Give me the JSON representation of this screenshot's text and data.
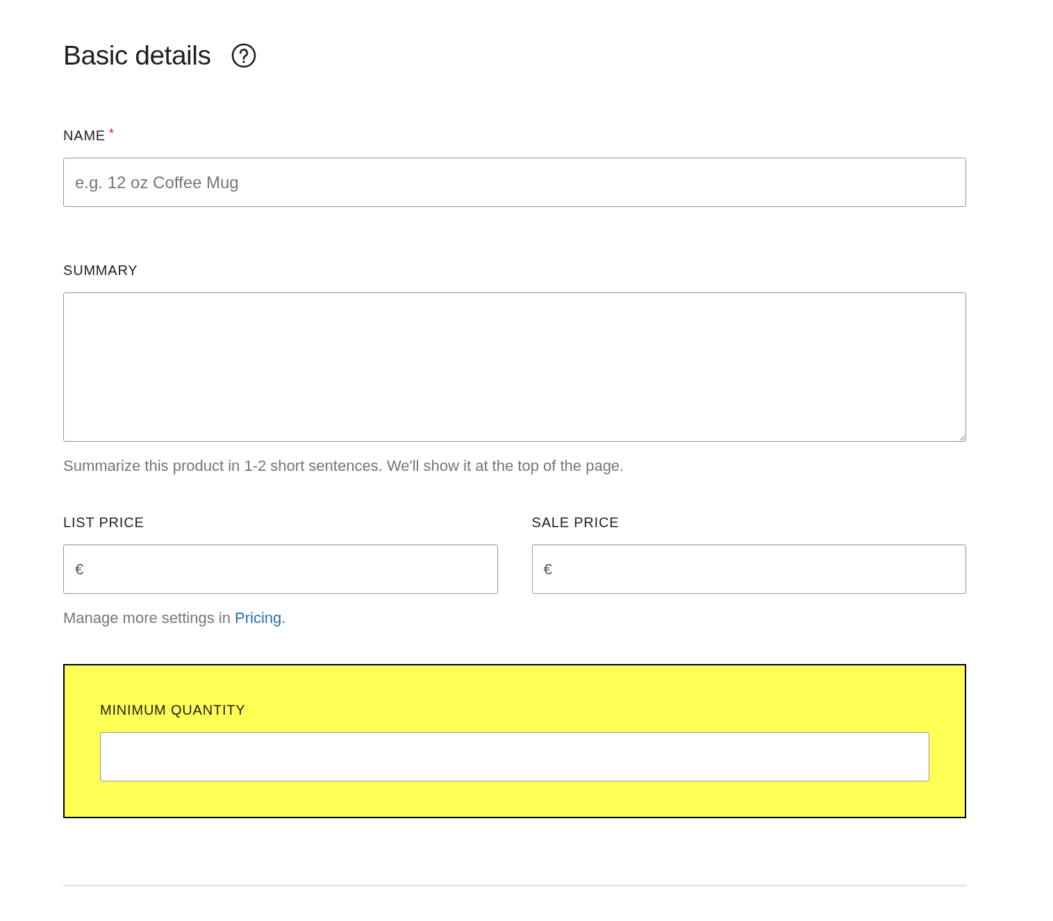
{
  "heading": {
    "title": "Basic details"
  },
  "fields": [
    {
      "kind": "text",
      "label": "NAME",
      "required_mark": "*",
      "placeholder": "e.g. 12 oz Coffee Mug"
    },
    {
      "kind": "textarea",
      "label": "SUMMARY",
      "hint": "Summarize this product in 1-2 short sentences. We'll show it at the top of the page."
    }
  ],
  "prices": [
    {
      "label": "LIST PRICE",
      "prefix": "€"
    },
    {
      "label": "SALE PRICE",
      "prefix": "€"
    }
  ],
  "pricing_note": {
    "text": "Manage more settings in",
    "link": "Pricing."
  },
  "highlight_box": {
    "label": "MINIMUM QUANTITY"
  }
}
